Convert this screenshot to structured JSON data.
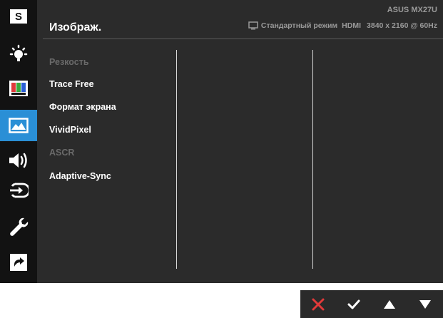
{
  "header": {
    "title": "Изображ.",
    "model": "ASUS MX27U",
    "mode": "Стандартный режим",
    "input": "HDMI",
    "resolution": "3840 x 2160 @ 60Hz"
  },
  "sidebar": {
    "items": [
      {
        "icon": "splendid-icon",
        "selected": false
      },
      {
        "icon": "blue-light-filter-icon",
        "selected": false
      },
      {
        "icon": "color-icon",
        "selected": false
      },
      {
        "icon": "image-icon",
        "selected": true
      },
      {
        "icon": "sound-icon",
        "selected": false
      },
      {
        "icon": "input-select-icon",
        "selected": false
      },
      {
        "icon": "system-setup-icon",
        "selected": false
      },
      {
        "icon": "shortcut-icon",
        "selected": false
      }
    ]
  },
  "menu": {
    "items": [
      {
        "label": "Резкость",
        "enabled": false
      },
      {
        "label": "Trace Free",
        "enabled": true
      },
      {
        "label": "Формат экрана",
        "enabled": true
      },
      {
        "label": "VividPixel",
        "enabled": true
      },
      {
        "label": "ASCR",
        "enabled": false
      },
      {
        "label": "Adaptive-Sync",
        "enabled": true
      }
    ]
  },
  "buttons": {
    "items": [
      {
        "icon": "close-icon",
        "color": "#e03a3a"
      },
      {
        "icon": "check-icon",
        "color": "#ffffff"
      },
      {
        "icon": "arrow-up-icon",
        "color": "#ffffff"
      },
      {
        "icon": "arrow-down-icon",
        "color": "#ffffff"
      }
    ]
  },
  "colors": {
    "accent": "#2a8fd6",
    "panel": "#2b2b2b",
    "sidebar": "#121212"
  }
}
